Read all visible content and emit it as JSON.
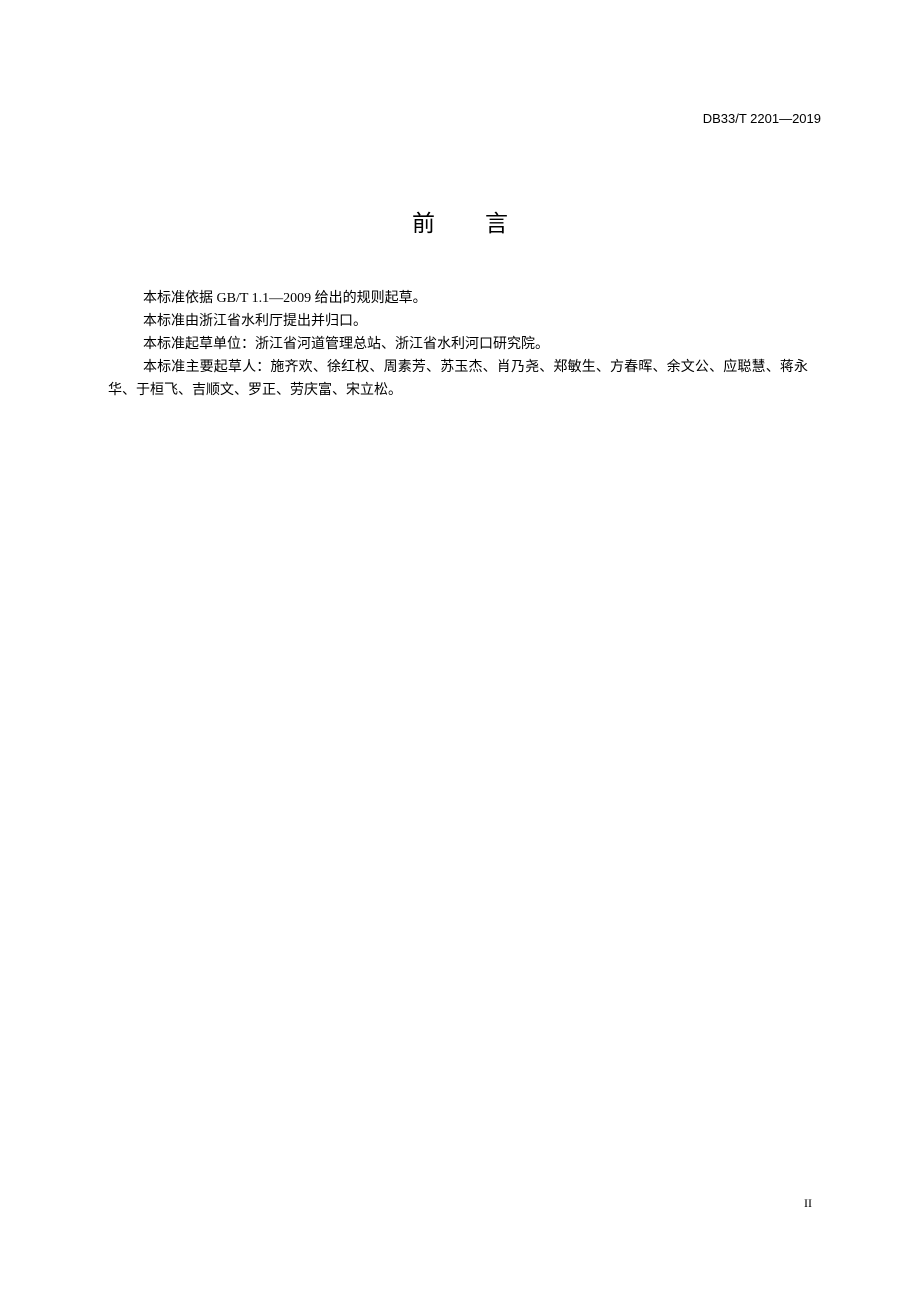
{
  "header": {
    "standard_code": "DB33/T 2201—2019"
  },
  "title": {
    "chars": [
      "前",
      "言"
    ]
  },
  "paragraphs": [
    "本标准依据 GB/T 1.1—2009 给出的规则起草。",
    "本标准由浙江省水利厅提出并归口。",
    "本标准起草单位：浙江省河道管理总站、浙江省水利河口研究院。",
    "本标准主要起草人：施齐欢、徐红权、周素芳、苏玉杰、肖乃尧、郑敏生、方春晖、余文公、应聪慧、蒋永华、于桓飞、吉顺文、罗正、劳庆富、宋立松。"
  ],
  "footer": {
    "page_number": "II"
  }
}
